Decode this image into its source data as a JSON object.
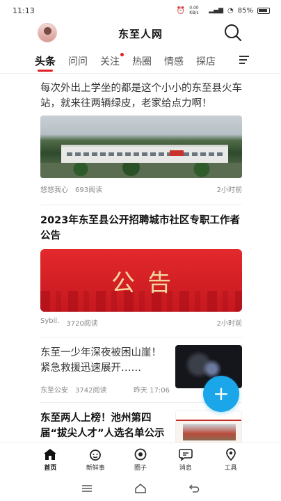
{
  "status_bar": {
    "time": "11:13",
    "battery": "85%",
    "net_speed": "0.00 KB/s"
  },
  "header": {
    "title": "东至人网"
  },
  "tabs": [
    {
      "label": "头条",
      "active": true
    },
    {
      "label": "问问"
    },
    {
      "label": "关注",
      "badge": true
    },
    {
      "label": "热圈"
    },
    {
      "label": "情感"
    },
    {
      "label": "探店"
    }
  ],
  "feed": {
    "articles": [
      {
        "title": "每次外出上学坐的都是这个小小的东至县火车站，就来往两辆绿皮，老家给点力啊！",
        "author": "悠悠我心",
        "reads": "693阅读",
        "time": "2小时前"
      },
      {
        "title": "2023年东至县公开招聘城市社区专职工作者公告",
        "image_text": "公告",
        "author": "Sybil.",
        "reads": "3720阅读",
        "time": "2小时前"
      },
      {
        "title": "东至一少年深夜被困山崖！紧急救援迅速展开……",
        "author": "东至公安",
        "reads": "3742阅读",
        "time": "昨天 17:06"
      },
      {
        "title": "东至两人上榜！池州第四届“拔尖人才”人选名单公示"
      }
    ]
  },
  "fab": {
    "label": "+"
  },
  "bottom_nav": [
    {
      "label": "首页",
      "icon": "home-icon",
      "active": true
    },
    {
      "label": "新鲜事",
      "icon": "face-icon"
    },
    {
      "label": "圈子",
      "icon": "circle-icon"
    },
    {
      "label": "消息",
      "icon": "message-icon"
    },
    {
      "label": "工具",
      "icon": "location-icon"
    }
  ],
  "colors": {
    "accent": "#e02020",
    "fab": "#1aa6e8",
    "notice_red": "#d5232a"
  }
}
